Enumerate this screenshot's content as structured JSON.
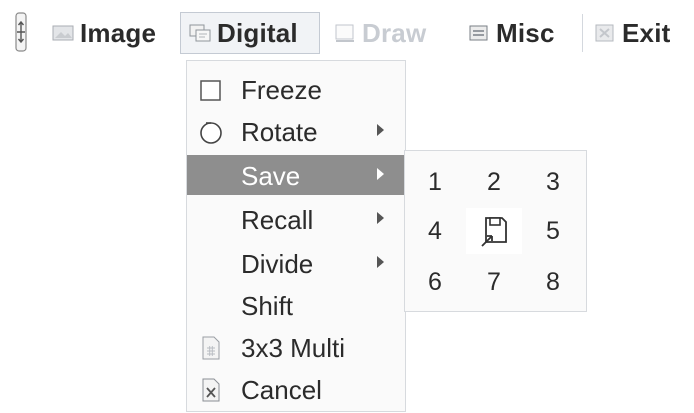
{
  "menubar": {
    "items": [
      {
        "label": "Image",
        "icon": "image-icon",
        "state": "normal"
      },
      {
        "label": "Digital",
        "icon": "digital-icon",
        "state": "active"
      },
      {
        "label": "Draw",
        "icon": "draw-icon",
        "state": "disabled"
      },
      {
        "label": "Misc",
        "icon": "misc-icon",
        "state": "normal"
      },
      {
        "label": "Exit",
        "icon": "exit-icon",
        "state": "normal"
      }
    ]
  },
  "digital_menu": {
    "items": [
      {
        "label": "Freeze",
        "icon": "checkbox-icon",
        "submenu": false
      },
      {
        "label": "Rotate",
        "icon": "rotate-icon",
        "submenu": true
      },
      {
        "label": "Save",
        "icon": "",
        "submenu": true,
        "selected": true
      },
      {
        "label": "Recall",
        "icon": "",
        "submenu": true
      },
      {
        "label": "Divide",
        "icon": "",
        "submenu": true
      },
      {
        "label": "Shift",
        "icon": "",
        "submenu": false
      },
      {
        "label": "3x3 Multi",
        "icon": "grid-icon",
        "submenu": false
      },
      {
        "label": "Cancel",
        "icon": "cancel-icon",
        "submenu": false
      }
    ]
  },
  "save_submenu": {
    "row1": [
      "1",
      "2",
      "3"
    ],
    "row2_left": "4",
    "center_icon": "save-icon",
    "row2_right": "5",
    "row3": [
      "6",
      "7",
      "8"
    ]
  },
  "colors": {
    "selected_bg": "#8e8e8e",
    "disabled_text": "#c8ccd2",
    "text": "#2b2b2b"
  }
}
